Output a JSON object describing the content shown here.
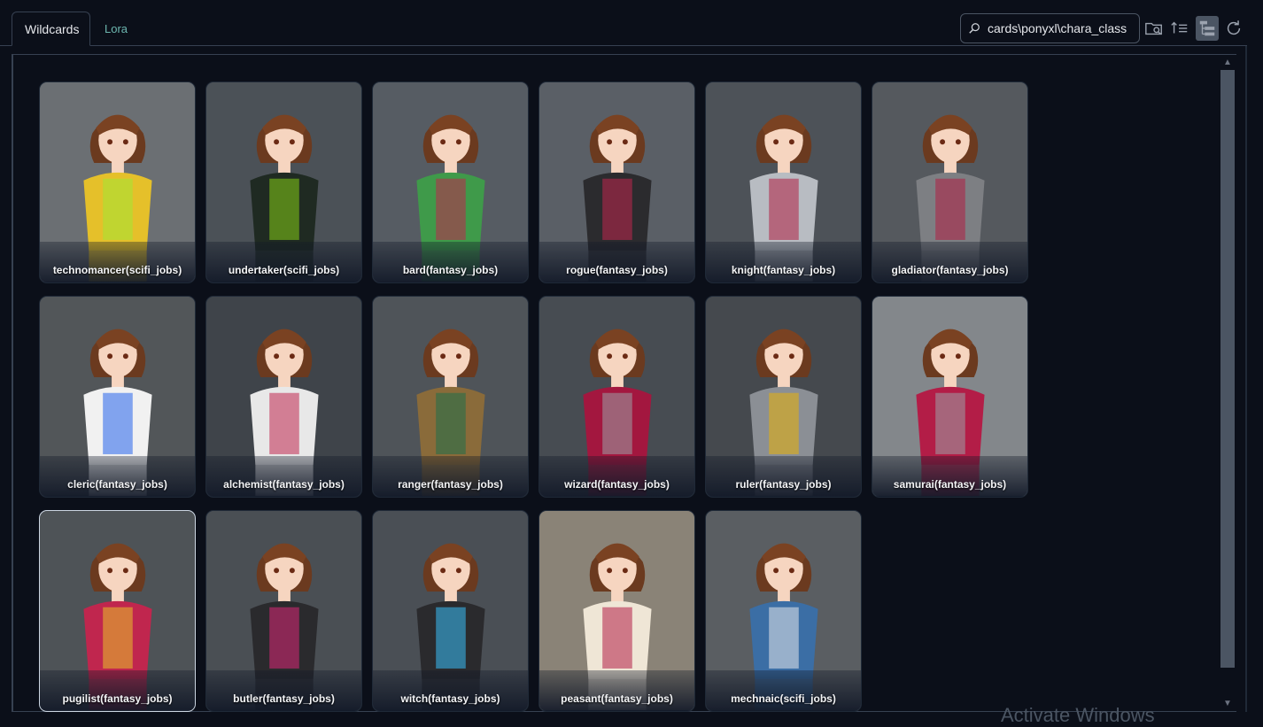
{
  "tabs": [
    {
      "label": "Wildcards",
      "active": true
    },
    {
      "label": "Lora",
      "active": false
    }
  ],
  "search": {
    "value": "cards\\ponyxl\\chara_class",
    "placeholder": ""
  },
  "toolbar": {
    "icons": [
      "folder-search-icon",
      "sort-icon",
      "tree-view-icon",
      "refresh-icon"
    ]
  },
  "cards": [
    {
      "label": "technomancer(scifi_jobs)",
      "bg": "#6b6f73",
      "outfit": "#e5c02a",
      "accent": "#a3e635"
    },
    {
      "label": "undertaker(scifi_jobs)",
      "bg": "#4b5157",
      "outfit": "#1f2a22",
      "accent": "#84cc16"
    },
    {
      "label": "bard(fantasy_jobs)",
      "bg": "#565c63",
      "outfit": "#3f9a4a",
      "accent": "#c0264e"
    },
    {
      "label": "rogue(fantasy_jobs)",
      "bg": "#5a5f66",
      "outfit": "#2b2b2e",
      "accent": "#c0264e"
    },
    {
      "label": "knight(fantasy_jobs)",
      "bg": "#4d5258",
      "outfit": "#b8bcc2",
      "accent": "#b01f44"
    },
    {
      "label": "gladiator(fantasy_jobs)",
      "bg": "#55595e",
      "outfit": "#7d7f83",
      "accent": "#b01f44"
    },
    {
      "label": "cleric(fantasy_jobs)",
      "bg": "#525659",
      "outfit": "#f1f1f1",
      "accent": "#2563eb"
    },
    {
      "label": "alchemist(fantasy_jobs)",
      "bg": "#3f444a",
      "outfit": "#e8e8e8",
      "accent": "#c0264e"
    },
    {
      "label": "ranger(fantasy_jobs)",
      "bg": "#4f5459",
      "outfit": "#8a6b3a",
      "accent": "#1f6f4a"
    },
    {
      "label": "wizard(fantasy_jobs)",
      "bg": "#474c52",
      "outfit": "#a3173f",
      "accent": "#9aa0a6"
    },
    {
      "label": "ruler(fantasy_jobs)",
      "bg": "#45494e",
      "outfit": "#8b8f95",
      "accent": "#eab308"
    },
    {
      "label": "samurai(fantasy_jobs)",
      "bg": "#83878b",
      "outfit": "#b31d47",
      "accent": "#9aa0a6"
    },
    {
      "label": "pugilist(fantasy_jobs)",
      "bg": "#4e5357",
      "outfit": "#c0264e",
      "accent": "#e5c02a"
    },
    {
      "label": "butler(fantasy_jobs)",
      "bg": "#4a4f54",
      "outfit": "#2a2a2d",
      "accent": "#db2777"
    },
    {
      "label": "witch(fantasy_jobs)",
      "bg": "#4a4f55",
      "outfit": "#2a2a2d",
      "accent": "#38bdf8"
    },
    {
      "label": "peasant(fantasy_jobs)",
      "bg": "#8a8377",
      "outfit": "#efe6d6",
      "accent": "#b31d47"
    },
    {
      "label": "mechnaic(scifi_jobs)",
      "bg": "#5a5e62",
      "outfit": "#3b6ea5",
      "accent": "#e5e7eb"
    }
  ],
  "selected_card_index": 12,
  "watermark": "Activate Windows"
}
